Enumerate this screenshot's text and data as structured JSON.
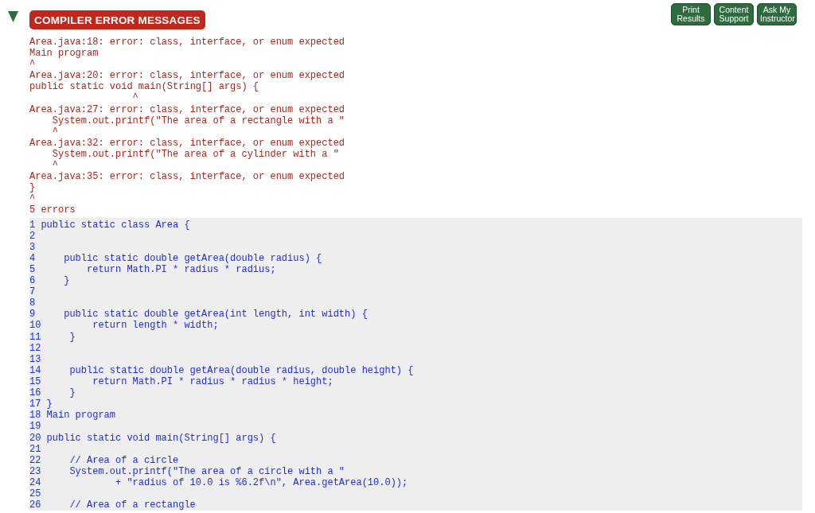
{
  "header": {
    "title": "COMPILER ERROR MESSAGES",
    "expanded": true,
    "buttons": [
      "Print Results",
      "Content Support",
      "Ask My Instructor"
    ]
  },
  "compiler_output": {
    "lines": [
      "Area.java:18: error: class, interface, or enum expected",
      "Main program",
      "^",
      "Area.java:20: error: class, interface, or enum expected",
      "public static void main(String[] args) {",
      "                  ^",
      "Area.java:27: error: class, interface, or enum expected",
      "    System.out.printf(\"The area of a rectangle with a \"",
      "    ^",
      "Area.java:32: error: class, interface, or enum expected",
      "    System.out.printf(\"The area of a cylinder with a \"",
      "    ^",
      "Area.java:35: error: class, interface, or enum expected",
      "}",
      "^",
      "5 errors"
    ]
  },
  "code_listing": {
    "lines": [
      {
        "number": "1",
        "text": "public static class Area {"
      },
      {
        "number": "2"
      },
      {
        "number": "3"
      },
      {
        "number": "4",
        "text": "    public static double getArea(double radius) {"
      },
      {
        "number": "5",
        "text": "        return Math.PI * radius * radius;"
      },
      {
        "number": "6",
        "text": "    }"
      },
      {
        "number": "7"
      },
      {
        "number": "8"
      },
      {
        "number": "9",
        "text": "    public static double getArea(int length, int width) {"
      },
      {
        "number": "10",
        "text": "        return length * width;"
      },
      {
        "number": "11",
        "text": "    }"
      },
      {
        "number": "12"
      },
      {
        "number": "13"
      },
      {
        "number": "14",
        "text": "    public static double getArea(double radius, double height) {"
      },
      {
        "number": "15",
        "text": "        return Math.PI * radius * radius * height;"
      },
      {
        "number": "16",
        "text": "    }"
      },
      {
        "number": "17",
        "text": "}"
      },
      {
        "number": "18",
        "text": "Main program"
      },
      {
        "number": "19"
      },
      {
        "number": "20",
        "text": "public static void main(String[] args) {"
      },
      {
        "number": "21"
      },
      {
        "number": "22",
        "text": "    // Area of a circle"
      },
      {
        "number": "23",
        "text": "    System.out.printf(\"The area of a circle with a \""
      },
      {
        "number": "24",
        "text": "            + \"radius of 10.0 is %6.2f\\n\", Area.getArea(10.0));"
      },
      {
        "number": "25"
      },
      {
        "number": "26",
        "text": "    // Area of a rectangle"
      }
    ]
  }
}
